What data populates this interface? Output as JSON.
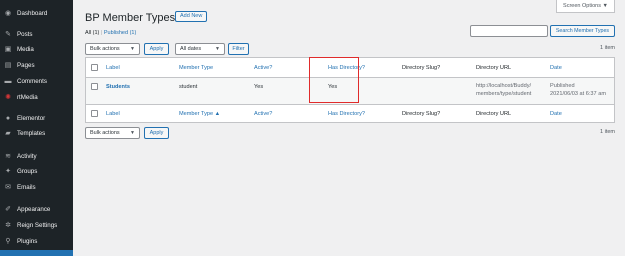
{
  "sidebar": {
    "items": [
      {
        "label": "Dashboard",
        "icon": "dashboard-icon",
        "glyph": "◉"
      },
      {
        "label": "Posts",
        "icon": "pin-icon",
        "glyph": "✎"
      },
      {
        "label": "Media",
        "icon": "media-icon",
        "glyph": "▣"
      },
      {
        "label": "Pages",
        "icon": "pages-icon",
        "glyph": "▤"
      },
      {
        "label": "Comments",
        "icon": "comments-icon",
        "glyph": "▬"
      },
      {
        "label": "rtMedia",
        "icon": "rtmedia-icon",
        "glyph": "✺"
      },
      {
        "label": "Elementor",
        "icon": "elementor-icon",
        "glyph": "●"
      },
      {
        "label": "Templates",
        "icon": "folder-icon",
        "glyph": "▰"
      },
      {
        "label": "Activity",
        "icon": "activity-icon",
        "glyph": "≋"
      },
      {
        "label": "Groups",
        "icon": "groups-icon",
        "glyph": "✦"
      },
      {
        "label": "Emails",
        "icon": "email-icon",
        "glyph": "✉"
      },
      {
        "label": "Appearance",
        "icon": "brush-icon",
        "glyph": "✐"
      },
      {
        "label": "Reign Settings",
        "icon": "gear-icon",
        "glyph": "✲"
      },
      {
        "label": "Plugins",
        "icon": "plugin-icon",
        "glyph": "⚲"
      }
    ]
  },
  "header": {
    "title": "BP Member Types",
    "add_new": "Add New",
    "screen_options": "Screen Options ▼"
  },
  "views": {
    "all": "All",
    "all_count": "(1)",
    "separator": "|",
    "published": "Published",
    "published_count": "(1)"
  },
  "search": {
    "placeholder": "",
    "button": "Search Member Types"
  },
  "top_nav": {
    "bulk_actions": "Bulk actions",
    "apply": "Apply",
    "dates": "All dates",
    "filter": "Filter",
    "count": "1 item"
  },
  "table": {
    "columns": [
      "Label",
      "Member Type",
      "Active?",
      "Has Directory?",
      "Directory Slug?",
      "Directory URL",
      "Date"
    ],
    "footer_columns": [
      "Label",
      "Member Type ▲",
      "Active?",
      "Has Directory?",
      "Directory Slug?",
      "Directory URL",
      "Date"
    ],
    "rows": [
      {
        "label": "Students",
        "member_type": "student",
        "active": "Yes",
        "has_directory": "Yes",
        "directory_slug": "",
        "directory_url_1": "http://localhost/Buddy/",
        "directory_url_2": "members/type/student",
        "date_status": "Published",
        "date_value": "2021/06/03 at 6:37 am"
      }
    ]
  },
  "bottom_nav": {
    "bulk_actions": "Bulk actions",
    "apply": "Apply",
    "count": "1 item"
  },
  "colors": {
    "sidebar_bg": "#1d2327",
    "link": "#2271b1",
    "highlight": "#e02b2b"
  }
}
